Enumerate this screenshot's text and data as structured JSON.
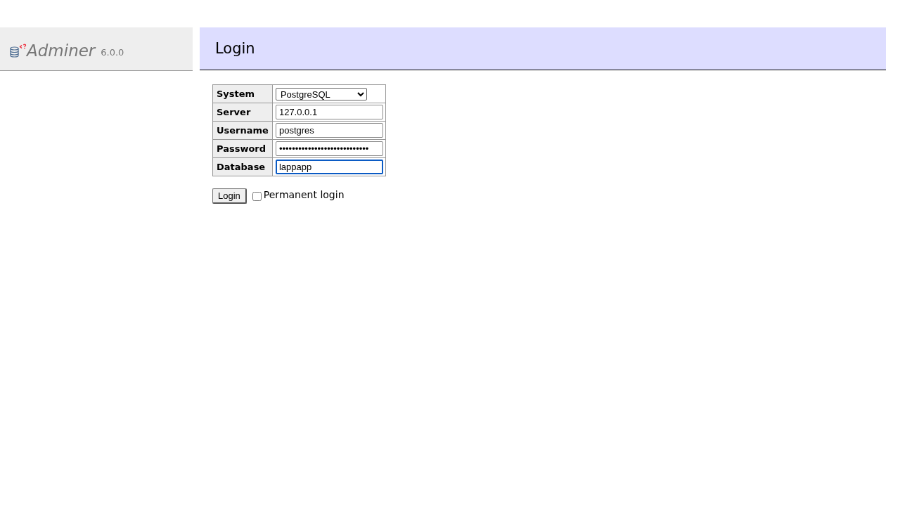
{
  "sidebar": {
    "logo": {
      "name": "Adminer",
      "version": "6.0.0"
    }
  },
  "page": {
    "title": "Login"
  },
  "form": {
    "fields": [
      {
        "label": "System",
        "kind": "select",
        "value": "PostgreSQL",
        "focused": false
      },
      {
        "label": "Server",
        "kind": "text",
        "value": "127.0.0.1",
        "focused": false
      },
      {
        "label": "Username",
        "kind": "text",
        "value": "postgres",
        "focused": false
      },
      {
        "label": "Password",
        "kind": "password",
        "value": "••••••••••••••••••••••••••••",
        "focused": false
      },
      {
        "label": "Database",
        "kind": "text",
        "value": "lappapp",
        "focused": true
      }
    ],
    "submit": "Login",
    "permanent_login": {
      "label": "Permanent login",
      "checked": false
    }
  }
}
